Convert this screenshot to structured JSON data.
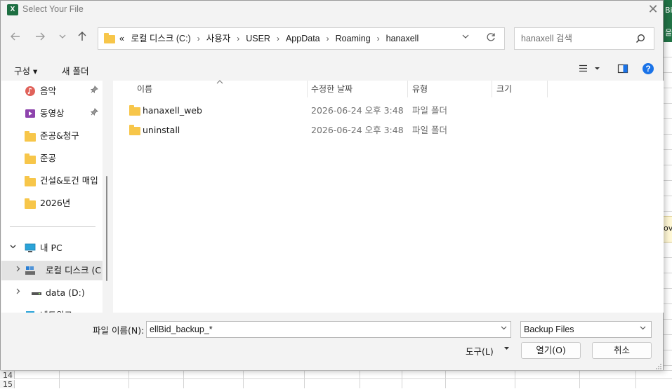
{
  "excel_background": {
    "ribbon_fragment_top": "Bi",
    "ribbon_fragment_bottom": "을",
    "cell_fragment": "ov",
    "row_numbers": [
      "14",
      "15"
    ]
  },
  "dialog": {
    "title": "Select Your File",
    "app_icon_letter": "X",
    "close_glyph": "✕"
  },
  "address": {
    "overflow": "«",
    "breadcrumbs": [
      "로컬 디스크 (C:)",
      "사용자",
      "USER",
      "AppData",
      "Roaming",
      "hanaxell"
    ]
  },
  "search": {
    "placeholder": "hanaxell 검색"
  },
  "toolbar": {
    "organize_label": "구성 ▾",
    "new_folder_label": "새 폴더"
  },
  "nav_pane": {
    "items": [
      {
        "label": "음악",
        "pinned": true
      },
      {
        "label": "동영상",
        "pinned": true
      },
      {
        "label": "준공&청구"
      },
      {
        "label": "준공"
      },
      {
        "label": "건설&토건 매입"
      },
      {
        "label": "2026년"
      },
      {
        "label": "내 PC"
      },
      {
        "label": "로컬 디스크 (C"
      },
      {
        "label": "data (D:)"
      },
      {
        "label": "네트워크"
      }
    ]
  },
  "file_pane": {
    "columns": [
      "이름",
      "수정한 날짜",
      "유형",
      "크기"
    ],
    "rows": [
      {
        "name": "hanaxell_web",
        "date": "2026-06-24 오후 3:48",
        "type": "파일 폴더",
        "size": ""
      },
      {
        "name": "uninstall",
        "date": "2026-06-24 오후 3:48",
        "type": "파일 폴더",
        "size": ""
      }
    ]
  },
  "bottom": {
    "filename_label": "파일 이름(N):",
    "filename_value": "ellBid_backup_*",
    "filetype_value": "Backup Files",
    "tools_label": "도구(L)",
    "open_label": "열기(O)",
    "cancel_label": "취소"
  },
  "colors": {
    "excel_green": "#217346",
    "folder_yellow": "#f7c64a",
    "help_blue": "#1a73e8"
  }
}
